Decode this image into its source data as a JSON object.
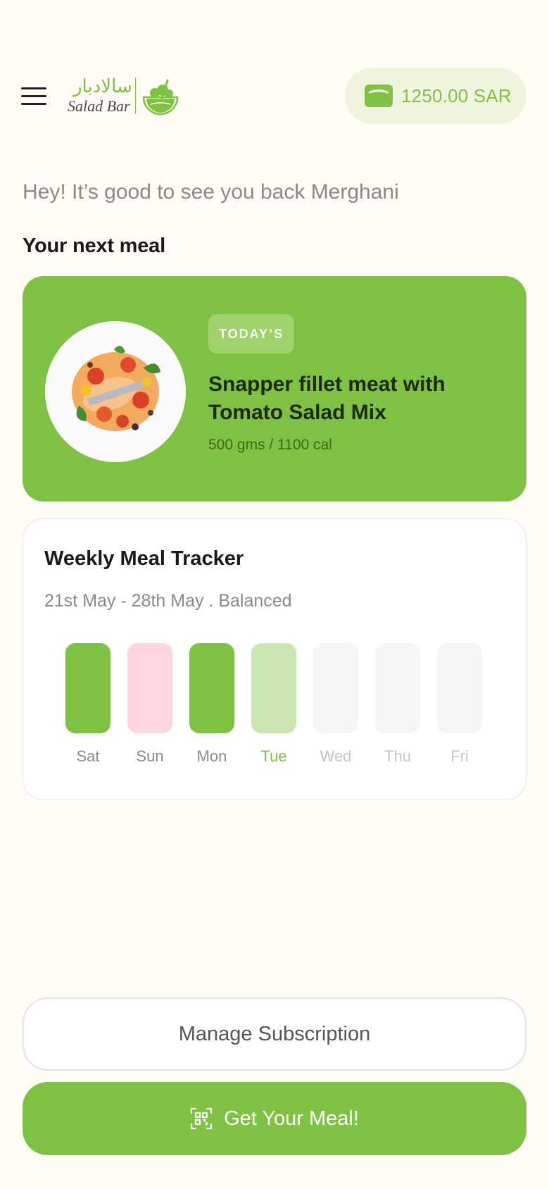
{
  "header": {
    "logo_arabic": "سالادبار",
    "logo_english": "Salad Bar",
    "wallet_amount": "1250.00 SAR"
  },
  "greeting": "Hey! It’s good to see you back Merghani",
  "next_meal": {
    "section_title": "Your next meal",
    "badge": "TODAY’S",
    "name": "Snapper fillet meat with Tomato Salad Mix",
    "info": "500 gms / 1100 cal"
  },
  "tracker": {
    "title": "Weekly Meal Tracker",
    "subtitle": "21st May - 28th May . Balanced",
    "days": [
      {
        "label": "Sat",
        "status": "eaten",
        "bar_color": "#7fc142",
        "label_color": "#8a8a8a"
      },
      {
        "label": "Sun",
        "status": "missed",
        "bar_color": "#fdd6de",
        "label_color": "#8a8a8a"
      },
      {
        "label": "Mon",
        "status": "eaten",
        "bar_color": "#7fc142",
        "label_color": "#8a8a8a"
      },
      {
        "label": "Tue",
        "status": "today",
        "bar_color": "#cce6b2",
        "label_color": "#7fc142"
      },
      {
        "label": "Wed",
        "status": "upcoming",
        "bar_color": "#f5f5f5",
        "label_color": "#c4c4c4"
      },
      {
        "label": "Thu",
        "status": "upcoming",
        "bar_color": "#f5f5f5",
        "label_color": "#c4c4c4"
      },
      {
        "label": "Fri",
        "status": "upcoming",
        "bar_color": "#f5f5f5",
        "label_color": "#c4c4c4"
      }
    ]
  },
  "buttons": {
    "manage": "Manage Subscription",
    "get_meal": "Get Your Meal!"
  },
  "colors": {
    "accent": "#7fc142",
    "background": "#fefcf4"
  },
  "icons": [
    "menu-icon",
    "wallet-icon",
    "qr-code-icon",
    "salad-bowl-logo"
  ]
}
